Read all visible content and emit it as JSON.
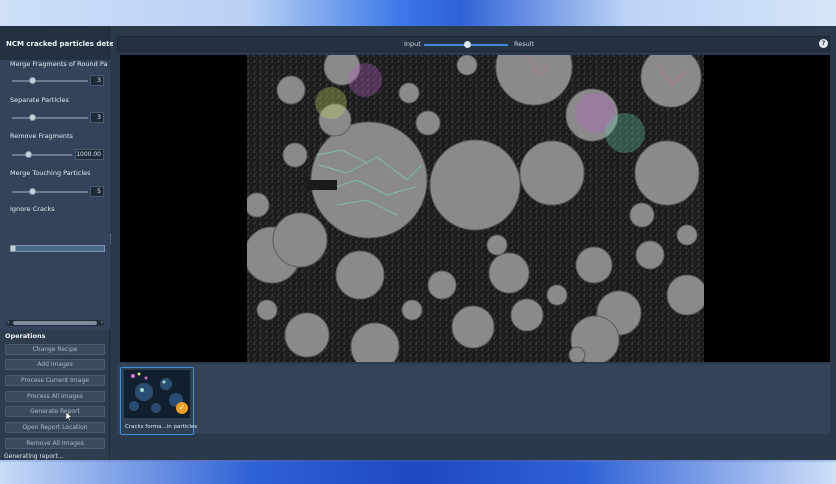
{
  "panel": {
    "title": "NCM cracked particles detection",
    "params": [
      {
        "label": "Merge Fragments of Round Particles",
        "value": "3"
      },
      {
        "label": "Separate Particles",
        "value": "3"
      },
      {
        "label": "Remove Fragments",
        "value": "1000.00"
      },
      {
        "label": "Merge Touching Particles",
        "value": "5"
      },
      {
        "label": "Ignore Cracks",
        "value": ""
      }
    ]
  },
  "operations": {
    "title": "Operations",
    "buttons": [
      "Change Recipe",
      "Add Images",
      "Process Current Image",
      "Process All Images",
      "Generate Report",
      "Open Report Location",
      "Remove All Images"
    ]
  },
  "status": "Generating report...",
  "viewer": {
    "input_label": "Input",
    "result_label": "Result",
    "slider_position": 0.5,
    "help_symbol": "?"
  },
  "thumbnails": [
    {
      "label": "Cracks forma...in particles",
      "processed": true
    }
  ],
  "icons": [
    "help-icon",
    "check-icon",
    "chevron-left-icon",
    "chevron-right-icon",
    "cursor-icon"
  ],
  "colors": {
    "accent": "#3d88dc",
    "check": "#f0a020",
    "panel": "#2e3d4e"
  }
}
